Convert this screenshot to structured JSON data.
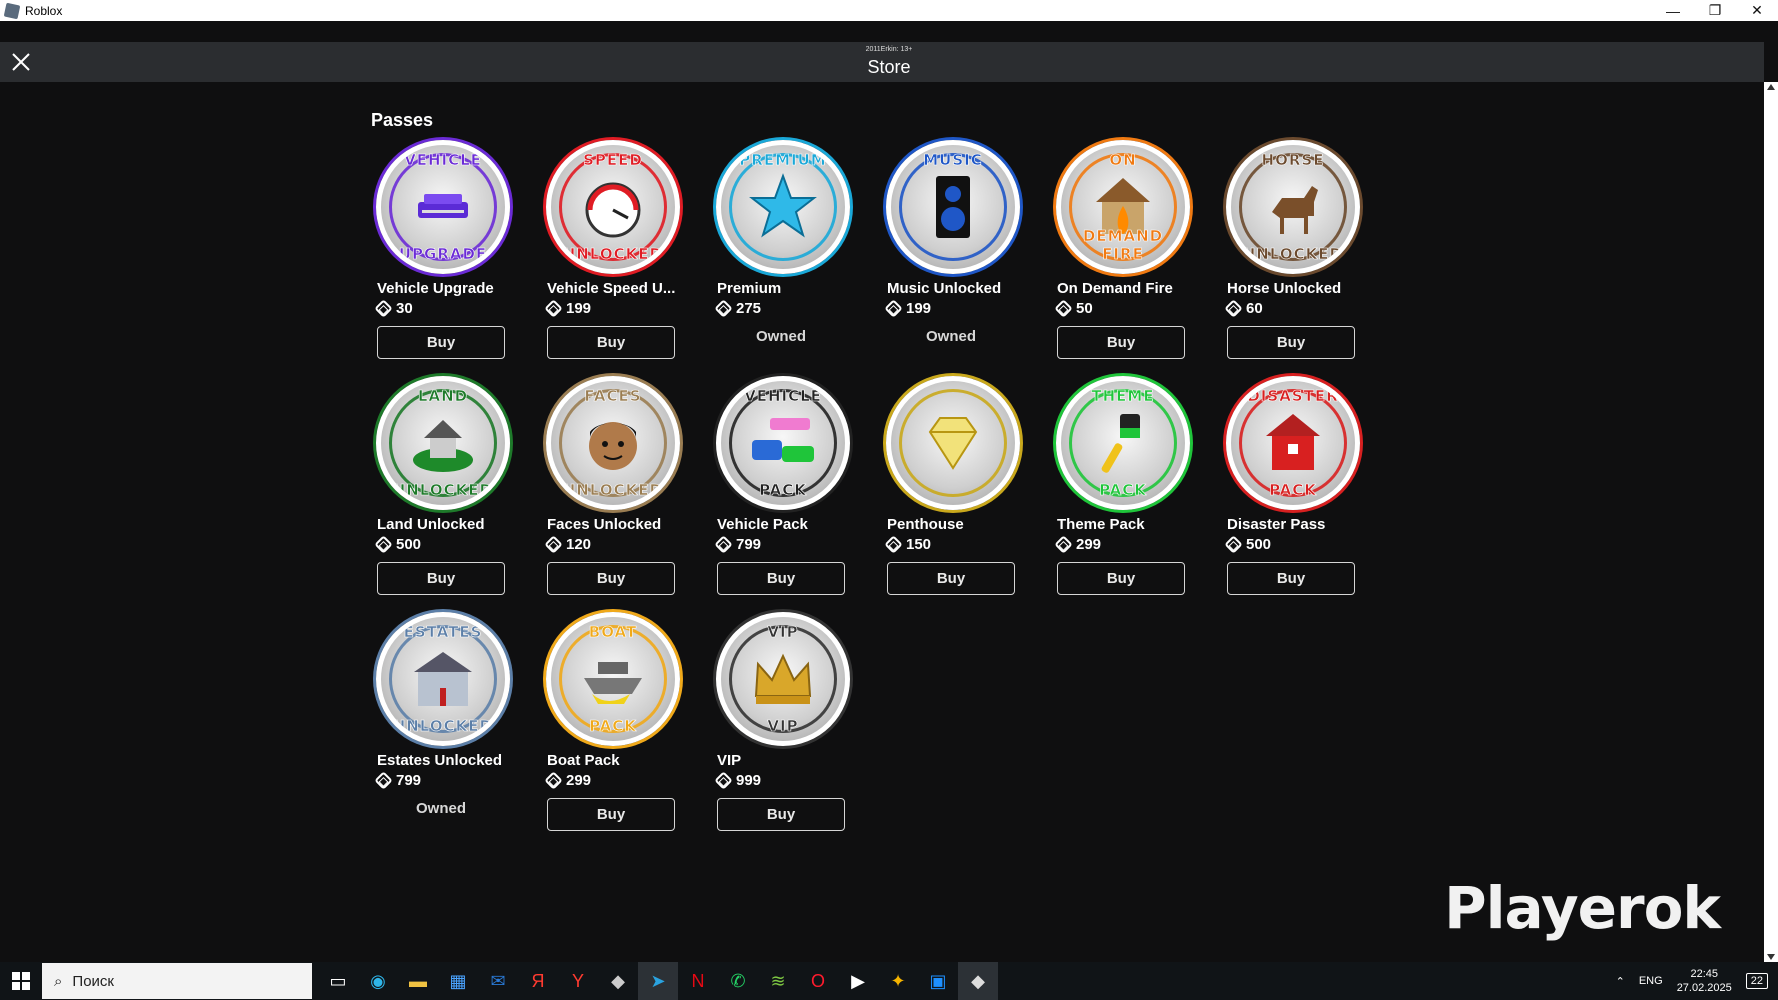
{
  "window": {
    "title": "Roblox",
    "minimize": "—",
    "maximize": "❐",
    "close": "✕"
  },
  "header": {
    "user_tag": "2011Erkin: 13+",
    "title": "Store"
  },
  "section": {
    "title": "Passes"
  },
  "items": [
    {
      "name": "Vehicle Upgrade",
      "price": "30",
      "status": "buy",
      "action": "Buy",
      "top": "VEHICLE",
      "bottom": "UPGRADE",
      "color": "#6b2bd6",
      "icon": "vehicle-icon"
    },
    {
      "name": "Vehicle Speed U...",
      "price": "199",
      "status": "buy",
      "action": "Buy",
      "top": "SPEED",
      "bottom": "UNLOCKED",
      "color": "#e01c24",
      "icon": "speedometer-icon"
    },
    {
      "name": "Premium",
      "price": "275",
      "status": "owned",
      "action": "Owned",
      "top": "PREMIUM",
      "bottom": "",
      "color": "#1aa8d8",
      "icon": "star-icon"
    },
    {
      "name": "Music Unlocked",
      "price": "199",
      "status": "owned",
      "action": "Owned",
      "top": "MUSIC",
      "bottom": "",
      "color": "#1f57c7",
      "icon": "speaker-icon"
    },
    {
      "name": "On Demand Fire",
      "price": "50",
      "status": "buy",
      "action": "Buy",
      "top": "ON",
      "bottom": "DEMAND FIRE",
      "color": "#f07a12",
      "icon": "burning-house-icon"
    },
    {
      "name": "Horse Unlocked",
      "price": "60",
      "status": "buy",
      "action": "Buy",
      "top": "HORSE",
      "bottom": "UNLOCKED",
      "color": "#6b4a2e",
      "icon": "horse-icon"
    },
    {
      "name": "Land Unlocked",
      "price": "500",
      "status": "buy",
      "action": "Buy",
      "top": "LAND",
      "bottom": "UNLOCKED",
      "color": "#1e7a2a",
      "icon": "land-icon"
    },
    {
      "name": "Faces Unlocked",
      "price": "120",
      "status": "buy",
      "action": "Buy",
      "top": "FACES",
      "bottom": "UNLOCKED",
      "color": "#9a7d52",
      "icon": "face-icon"
    },
    {
      "name": "Vehicle Pack",
      "price": "799",
      "status": "buy",
      "action": "Buy",
      "top": "VEHICLE",
      "bottom": "PACK",
      "color": "#222222",
      "icon": "cars-icon"
    },
    {
      "name": "Penthouse",
      "price": "150",
      "status": "buy",
      "action": "Buy",
      "top": "",
      "bottom": "",
      "color": "#c9a81c",
      "icon": "diamond-icon"
    },
    {
      "name": "Theme Pack",
      "price": "299",
      "status": "buy",
      "action": "Buy",
      "top": "THEME",
      "bottom": "PACK",
      "color": "#1fc53a",
      "icon": "paintbrush-icon"
    },
    {
      "name": "Disaster Pass",
      "price": "500",
      "status": "buy",
      "action": "Buy",
      "top": "DISASTER",
      "bottom": "PACK",
      "color": "#d82020",
      "icon": "broken-house-icon"
    },
    {
      "name": "Estates Unlocked",
      "price": "799",
      "status": "owned",
      "action": "Owned",
      "top": "ESTATES",
      "bottom": "UNLOCKED",
      "color": "#5c7fa8",
      "icon": "mansion-icon"
    },
    {
      "name": "Boat Pack",
      "price": "299",
      "status": "buy",
      "action": "Buy",
      "top": "BOAT",
      "bottom": "PACK",
      "color": "#f0a91a",
      "icon": "boat-icon"
    },
    {
      "name": "VIP",
      "price": "999",
      "status": "buy",
      "action": "Buy",
      "top": "VIP",
      "bottom": "VIP",
      "color": "#333333",
      "icon": "crown-icon"
    }
  ],
  "watermark": "Playerok",
  "taskbar": {
    "search_placeholder": "Поиск",
    "language": "ENG",
    "time": "22:45",
    "date": "27.02.2025",
    "notifications": "22"
  }
}
